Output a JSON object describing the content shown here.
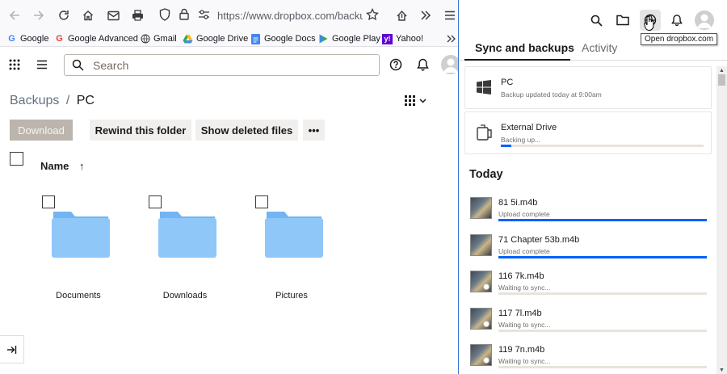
{
  "browser": {
    "url": "https://www.dropbox.com/backups/",
    "bookmarks": [
      {
        "label": "Google",
        "icon": "google-icon"
      },
      {
        "label": "Google Advanced",
        "icon": "google-icon"
      },
      {
        "label": "Gmail",
        "icon": "globe-icon"
      },
      {
        "label": "Google Drive",
        "icon": "google-drive-icon"
      },
      {
        "label": "Google Docs",
        "icon": "google-docs-icon"
      },
      {
        "label": "Google Play",
        "icon": "google-play-icon"
      },
      {
        "label": "Yahoo!",
        "icon": "yahoo-icon"
      }
    ]
  },
  "web": {
    "search_placeholder": "Search",
    "breadcrumb": {
      "root": "Backups",
      "separator": "/",
      "current": "PC"
    },
    "toolbar": {
      "download": "Download",
      "rewind": "Rewind this folder",
      "show_deleted": "Show deleted files",
      "more": "•••"
    },
    "column_header": "Name",
    "sort_arrow": "↑",
    "folders": [
      {
        "name": "Documents"
      },
      {
        "name": "Downloads"
      },
      {
        "name": "Pictures"
      }
    ],
    "colors": {
      "folder": "#90c7f9",
      "folder_tab": "#73b4f2"
    }
  },
  "panel": {
    "tooltip": "Open dropbox.com",
    "tabs": [
      {
        "label": "Sync and backups",
        "active": true
      },
      {
        "label": "Activity",
        "active": false
      }
    ],
    "devices": [
      {
        "name": "PC",
        "status": "Backup updated today at 9:00am",
        "progress": null
      },
      {
        "name": "External Drive",
        "status": "Backing up...",
        "progress": 0.05
      }
    ],
    "section_title": "Today",
    "files": [
      {
        "name": "81 5i.m4b",
        "status": "Upload complete",
        "progress": 1.0
      },
      {
        "name": "71 Chapter 53b.m4b",
        "status": "Upload complete",
        "progress": 1.0
      },
      {
        "name": "116 7k.m4b",
        "status": "Waiting to sync...",
        "progress": 0.0
      },
      {
        "name": "117 7l.m4b",
        "status": "Waiting to sync...",
        "progress": 0.0
      },
      {
        "name": "119 7n.m4b",
        "status": "Waiting to sync...",
        "progress": 0.0
      }
    ],
    "colors": {
      "accent": "#0061fe",
      "track": "#e8e4dc"
    }
  }
}
